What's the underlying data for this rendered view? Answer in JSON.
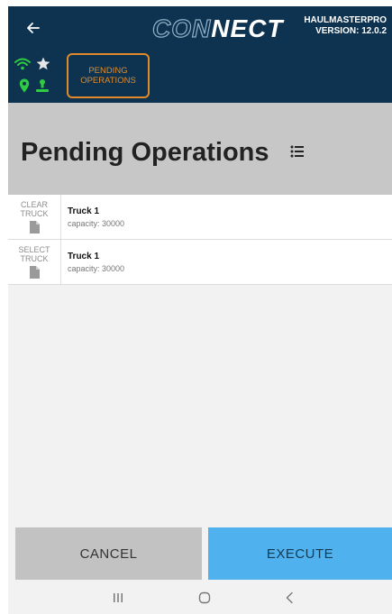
{
  "header": {
    "logo_prefix": "CON",
    "logo_suffix": "NECT",
    "app_name": "HAULMASTERPRO",
    "version": "VERSION: 12.0.2",
    "back_icon": "back-arrow-icon"
  },
  "status": {
    "icons": [
      "wifi-icon",
      "star-icon",
      "location-pin-icon",
      "user-icon"
    ],
    "active_color": "#2ecc40",
    "tab_label_line1": "PENDING",
    "tab_label_line2": "OPERATIONS",
    "tab_color": "#e08a2a"
  },
  "page": {
    "title": "Pending Operations"
  },
  "list": {
    "rows": [
      {
        "action_line1": "CLEAR",
        "action_line2": "TRUCK",
        "title": "Truck 1",
        "subtitle": "capacity: 30000"
      },
      {
        "action_line1": "SELECT",
        "action_line2": "TRUCK",
        "title": "Truck 1",
        "subtitle": "capacity: 30000"
      }
    ]
  },
  "footer": {
    "cancel_label": "CANCEL",
    "execute_label": "EXECUTE"
  },
  "colors": {
    "header_bg": "#0e3350",
    "title_band_bg": "#c7c7c7",
    "execute_bg": "#4fb2ee",
    "cancel_bg": "#c2c2c2"
  }
}
